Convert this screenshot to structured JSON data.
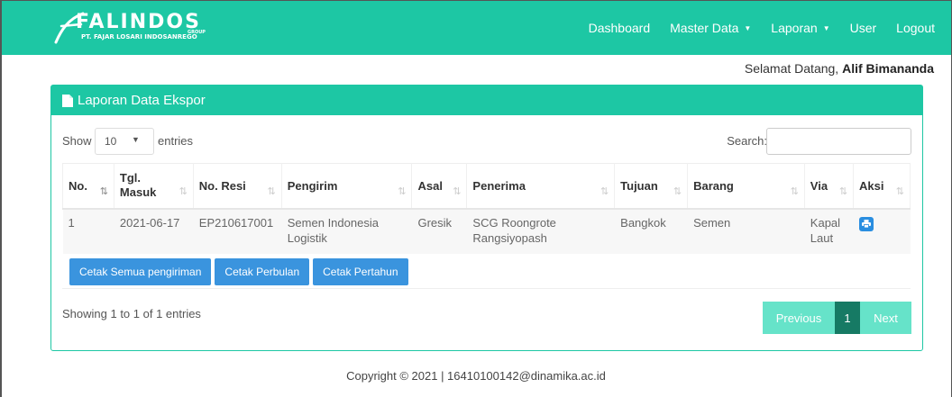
{
  "brand": {
    "name": "FALINDOS",
    "group": "GROUP",
    "subtitle": "PT. FAJAR LOSARI INDOSANREGO"
  },
  "nav": {
    "items": [
      {
        "label": "Dashboard"
      },
      {
        "label": "Master Data"
      },
      {
        "label": "Laporan"
      },
      {
        "label": "User"
      },
      {
        "label": "Logout"
      }
    ]
  },
  "welcome": {
    "greeting": "Selamat Datang,",
    "user": "Alif Bimananda"
  },
  "panel": {
    "title": "Laporan Data Ekspor"
  },
  "controls": {
    "show_label": "Show",
    "length_value": "10",
    "entries_label": "entries",
    "search_label": "Search:",
    "search_value": ""
  },
  "table": {
    "headers": [
      "No.",
      "Tgl. Masuk",
      "No. Resi",
      "Pengirim",
      "Asal",
      "Penerima",
      "Tujuan",
      "Barang",
      "Via",
      "Aksi"
    ],
    "rows": [
      {
        "no": "1",
        "tgl_masuk": "2021-06-17",
        "no_resi": "EP210617001",
        "pengirim": "Semen Indonesia Logistik",
        "asal": "Gresik",
        "penerima": "SCG Roongrote Rangsiyopash",
        "tujuan": "Bangkok",
        "barang": "Semen",
        "via": "Kapal Laut"
      }
    ]
  },
  "buttons": {
    "all": "Cetak Semua pengiriman",
    "monthly": "Cetak Perbulan",
    "yearly": "Cetak Pertahun"
  },
  "info": "Showing 1 to 1 of 1 entries",
  "pagination": {
    "previous": "Previous",
    "current": "1",
    "next": "Next"
  },
  "footer": "Copyright © 2021 | 16410100142@dinamika.ac.id",
  "colors": {
    "primary": "#1dc7a4",
    "button": "#3a94de",
    "page_active": "#167a64"
  }
}
